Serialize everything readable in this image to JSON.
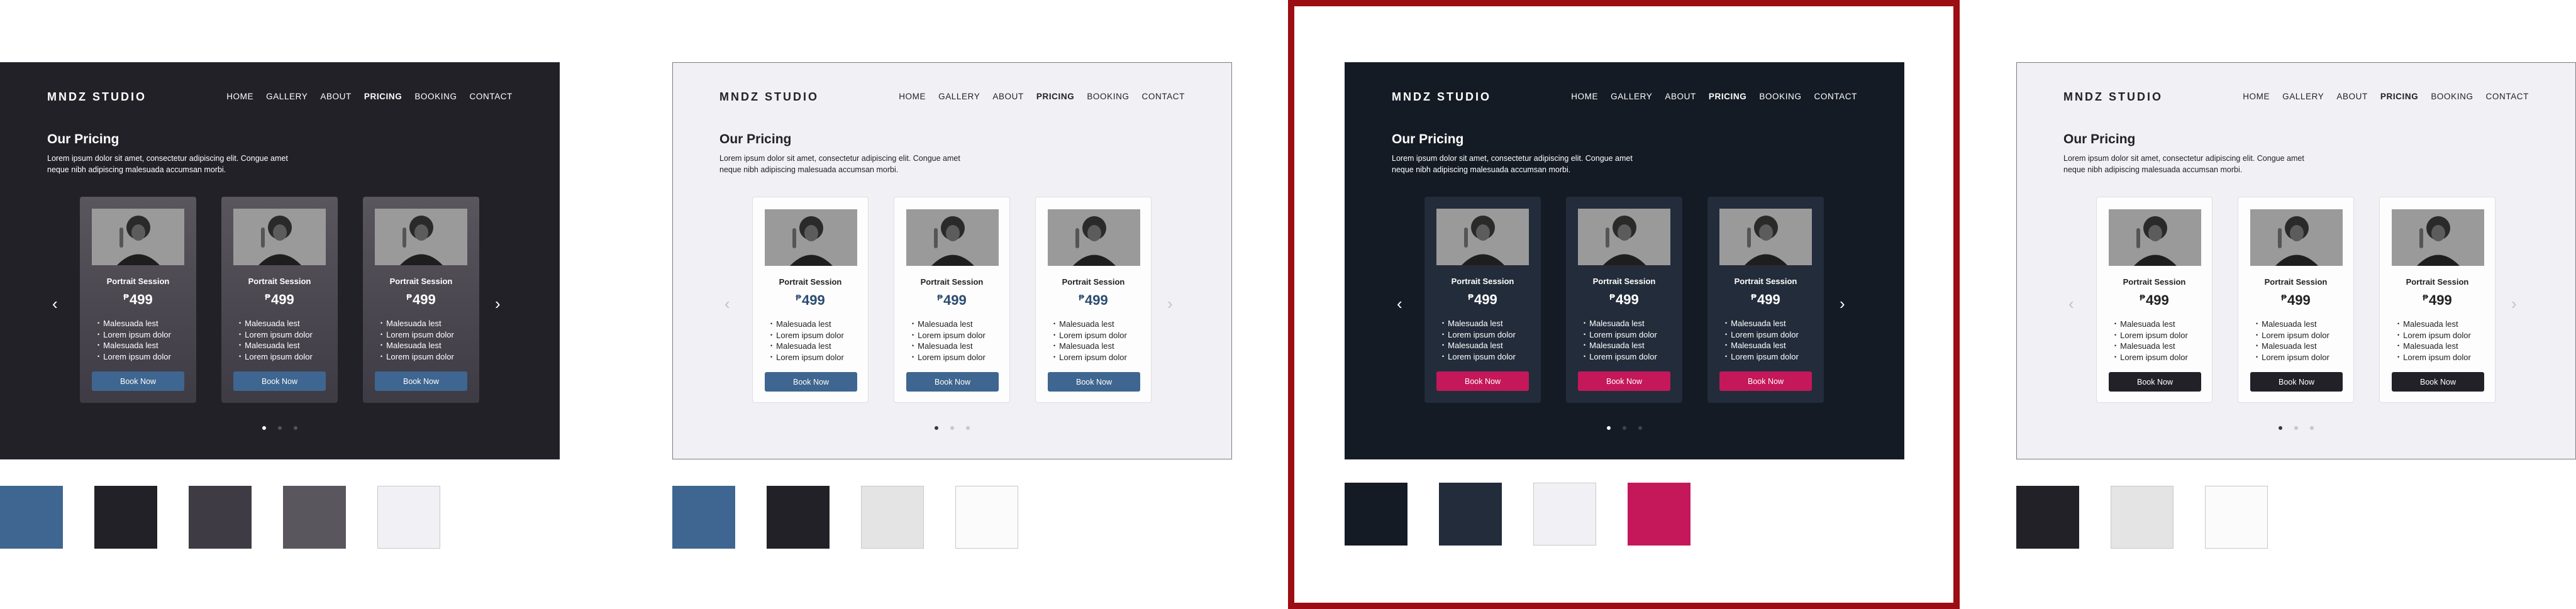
{
  "nav": {
    "logo": "MNDZ STUDIO",
    "items": [
      "HOME",
      "GALLERY",
      "ABOUT",
      "PRICING",
      "BOOKING",
      "CONTACT"
    ]
  },
  "pricing": {
    "title": "Our Pricing",
    "description": "Lorem ipsum dolor sit amet, consectetur adipiscing elit. Congue amet neque nibh adipiscing malesuada accumsan morbi."
  },
  "card": {
    "title": "Portrait Session",
    "currency": "₱",
    "price": "499",
    "features": [
      "Malesuada lest",
      "Lorem ipsum dolor",
      "Malesuada lest",
      "Lorem ipsum dolor"
    ],
    "button": "Book Now"
  },
  "arrows": {
    "left": "‹",
    "right": "›"
  },
  "palettes": [
    [
      "#3e6690",
      "#232128",
      "#3e3b44",
      "#59565e",
      "#f1f0f5"
    ],
    [
      "#3e6690",
      "#232128",
      "#e4e4e4",
      "#fbfbfb"
    ],
    [
      "#151b24",
      "#232c3b",
      "#f1f0f5",
      "#c4185a"
    ],
    [
      "#232128",
      "#e4e4e4",
      "#fbfbfb"
    ]
  ]
}
